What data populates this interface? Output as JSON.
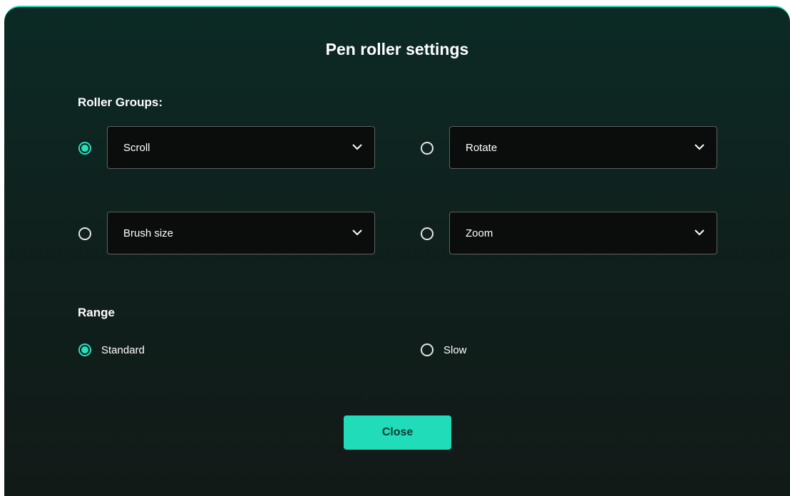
{
  "dialog": {
    "title": "Pen roller settings",
    "accent_color": "#27e1bd",
    "button_color": "#20dcb8"
  },
  "roller_groups": {
    "label": "Roller Groups:",
    "selected": "scroll",
    "options": [
      {
        "id": "scroll",
        "value": "Scroll",
        "checked": true
      },
      {
        "id": "rotate",
        "value": "Rotate",
        "checked": false
      },
      {
        "id": "brush-size",
        "value": "Brush size",
        "checked": false
      },
      {
        "id": "zoom",
        "value": "Zoom",
        "checked": false
      }
    ]
  },
  "range": {
    "label": "Range",
    "selected": "standard",
    "options": [
      {
        "id": "standard",
        "label": "Standard",
        "checked": true
      },
      {
        "id": "slow",
        "label": "Slow",
        "checked": false
      }
    ]
  },
  "footer": {
    "close_label": "Close"
  },
  "icons": {
    "dropdown": "chevron-down-icon"
  }
}
